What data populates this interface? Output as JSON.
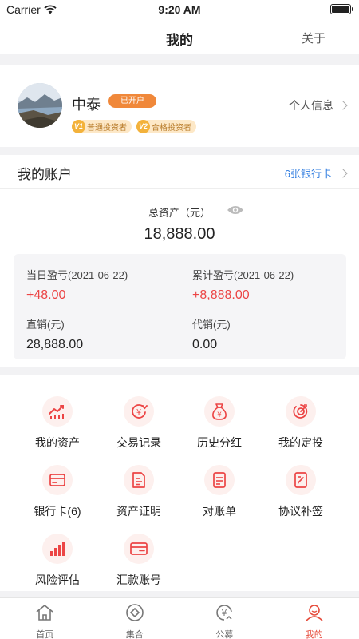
{
  "status_bar": {
    "carrier": "Carrier",
    "time": "9:20 AM"
  },
  "nav": {
    "title": "我的",
    "about": "关于"
  },
  "profile": {
    "name": "中泰",
    "open_badge": "已开户",
    "levels": [
      {
        "level": "V1",
        "label": "普通投资者"
      },
      {
        "level": "V2",
        "label": "合格投资者"
      }
    ],
    "info_link": "个人信息"
  },
  "account": {
    "title": "我的账户",
    "bank_cards": "6张银行卡",
    "total_label": "总资产（元）",
    "total_value": "18,888.00",
    "stats": {
      "daily_label": "当日盈亏(2021-06-22)",
      "daily_value": "+48.00",
      "cumulative_label": "累计盈亏(2021-06-22)",
      "cumulative_value": "+8,888.00",
      "direct_label": "直销(元)",
      "direct_value": "28,888.00",
      "agency_label": "代销(元)",
      "agency_value": "0.00"
    }
  },
  "features": [
    {
      "label": "我的资产",
      "icon": "chart-icon"
    },
    {
      "label": "交易记录",
      "icon": "yen-refresh-icon"
    },
    {
      "label": "历史分红",
      "icon": "money-bag-icon"
    },
    {
      "label": "我的定投",
      "icon": "target-icon"
    },
    {
      "label": "银行卡(6)",
      "icon": "card-icon"
    },
    {
      "label": "资产证明",
      "icon": "document-icon"
    },
    {
      "label": "对账单",
      "icon": "statement-icon"
    },
    {
      "label": "协议补签",
      "icon": "sign-icon"
    },
    {
      "label": "风险评估",
      "icon": "bars-icon"
    },
    {
      "label": "汇款账号",
      "icon": "remit-card-icon"
    }
  ],
  "tabs": [
    {
      "label": "首页",
      "icon": "home-icon"
    },
    {
      "label": "集合",
      "icon": "diamond-circle-icon"
    },
    {
      "label": "公募",
      "icon": "fund-icon"
    },
    {
      "label": "我的",
      "icon": "user-icon",
      "active": true
    }
  ],
  "colors": {
    "accent_red": "#ec4545",
    "orange": "#f0883a",
    "link_blue": "#2f7ce0"
  }
}
